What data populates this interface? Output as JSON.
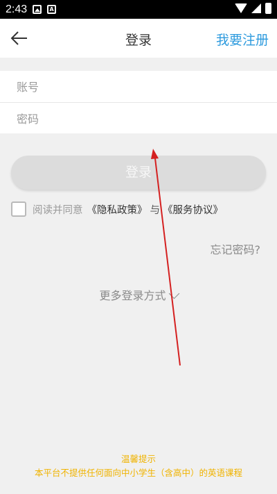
{
  "status_bar": {
    "time": "2:43"
  },
  "header": {
    "title": "登录",
    "register_link": "我要注册"
  },
  "form": {
    "account_placeholder": "账号",
    "password_placeholder": "密码"
  },
  "login_button": {
    "label": "登录"
  },
  "agreement": {
    "text": "阅读并同意",
    "privacy_link": "《隐私政策》",
    "and_text": "与",
    "service_link": "《服务协议》"
  },
  "forgot_password": "忘记密码?",
  "more_login": "更多登录方式",
  "tips": {
    "title": "温馨提示",
    "message": "本平台不提供任何面向中小学生（含高中）的英语课程"
  },
  "colors": {
    "accent": "#2e9bde",
    "tips": "#f0b300",
    "annotation": "#d42020"
  }
}
